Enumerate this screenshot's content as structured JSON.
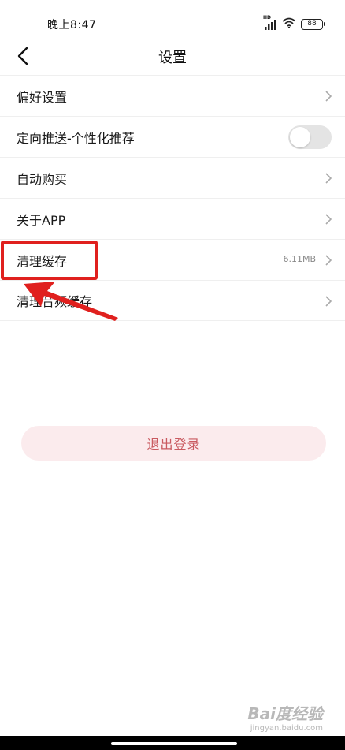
{
  "status_bar": {
    "time": "晚上8:47",
    "signal_label": "HD",
    "battery": "88"
  },
  "nav": {
    "title": "设置"
  },
  "settings": [
    {
      "label": "偏好设置",
      "type": "link"
    },
    {
      "label": "定向推送-个性化推荐",
      "type": "toggle",
      "enabled": false
    },
    {
      "label": "自动购买",
      "type": "link"
    },
    {
      "label": "关于APP",
      "type": "link"
    },
    {
      "label": "清理缓存",
      "type": "link",
      "value": "6.11MB"
    },
    {
      "label": "清理音频缓存",
      "type": "link"
    }
  ],
  "logout": {
    "label": "退出登录"
  },
  "watermark": {
    "logo": "Bai度经验",
    "url": "jingyan.baidu.com"
  },
  "colors": {
    "accent": "#c95a60",
    "logout_bg": "#fbebed",
    "annotation": "#e0201e",
    "toggle_off": "#e4e4e4"
  }
}
